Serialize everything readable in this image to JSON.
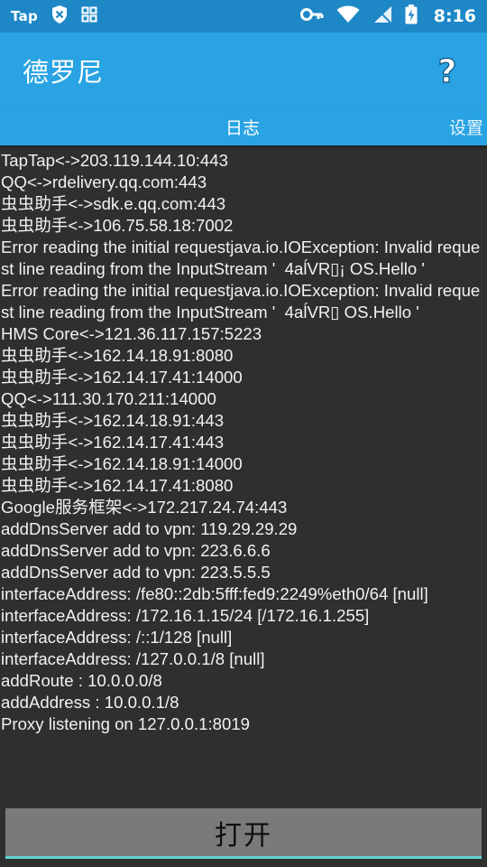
{
  "status_bar": {
    "left_label": "Tap",
    "time": "8:16",
    "icons": [
      "tap-app-icon",
      "shield-icon",
      "grid-icon",
      "key-icon",
      "wifi-icon",
      "no-sim-icon",
      "battery-charging-icon"
    ]
  },
  "app_bar": {
    "title": "德罗尼",
    "help_label": "?"
  },
  "tabs": [
    {
      "label": "日志",
      "selected": true
    },
    {
      "label": "设置",
      "selected": false
    }
  ],
  "log": [
    "TapTap<->203.119.144.10:443",
    "QQ<->rdelivery.qq.com:443",
    "虫虫助手<->sdk.e.qq.com:443",
    "虫虫助手<->106.75.58.18:7002",
    "Error reading the initial requestjava.io.IOException: Invalid request line reading from the InputStream '  4aĺVR▯¡ OS.Hello '",
    "Error reading the initial requestjava.io.IOException: Invalid request line reading from the InputStream '  4aĺVR▯ OS.Hello '",
    "HMS Core<->121.36.117.157:5223",
    "虫虫助手<->162.14.18.91:8080",
    "虫虫助手<->162.14.17.41:14000",
    "QQ<->111.30.170.211:14000",
    "虫虫助手<->162.14.18.91:443",
    "虫虫助手<->162.14.17.41:443",
    "虫虫助手<->162.14.18.91:14000",
    "虫虫助手<->162.14.17.41:8080",
    "Google服务框架<->172.217.24.74:443",
    "addDnsServer add to vpn: 119.29.29.29",
    "addDnsServer add to vpn: 223.6.6.6",
    "addDnsServer add to vpn: 223.5.5.5",
    "interfaceAddress: /fe80::2db:5fff:fed9:2249%eth0/64 [null]",
    "interfaceAddress: /172.16.1.15/24 [/172.16.1.255]",
    "interfaceAddress: /::1/128 [null]",
    "interfaceAddress: /127.0.0.1/8 [null]",
    "addRoute : 10.0.0.0/8",
    "addAddress : 10.0.0.1/8",
    "Proxy listening on 127.0.0.1:8019"
  ],
  "open_button": {
    "label": "打开"
  },
  "colors": {
    "status_bar": "#1e88c7",
    "app_bar": "#29a3e3",
    "background": "#2f2f2f",
    "button": "#7a7a7a",
    "button_underline": "#62d3cf"
  }
}
